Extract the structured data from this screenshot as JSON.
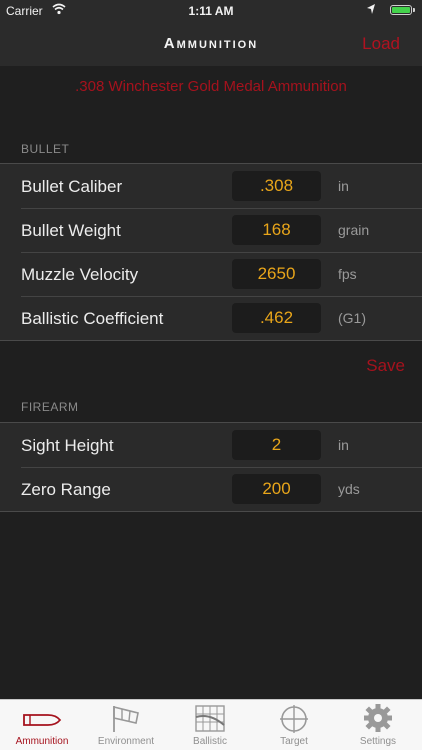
{
  "status": {
    "carrier": "Carrier",
    "time": "1:11 AM"
  },
  "nav": {
    "title": "Ammunition",
    "load_label": "Load"
  },
  "ammo_name": ".308 Winchester Gold Medal Ammunition",
  "bullet_section": {
    "header": "BULLET",
    "rows": [
      {
        "label": "Bullet Caliber",
        "value": ".308",
        "unit": "in"
      },
      {
        "label": "Bullet Weight",
        "value": "168",
        "unit": "grain"
      },
      {
        "label": "Muzzle Velocity",
        "value": "2650",
        "unit": "fps"
      },
      {
        "label": "Ballistic Coefficient",
        "value": ".462",
        "unit": "(G1)"
      }
    ]
  },
  "save_label": "Save",
  "firearm_section": {
    "header": "FIREARM",
    "rows": [
      {
        "label": "Sight Height",
        "value": "2",
        "unit": "in"
      },
      {
        "label": "Zero Range",
        "value": "200",
        "unit": "yds"
      }
    ]
  },
  "tabs": [
    {
      "label": "Ammunition",
      "icon": "bullet-icon"
    },
    {
      "label": "Environment",
      "icon": "windsock-icon"
    },
    {
      "label": "Ballistic",
      "icon": "ballistic-chart-icon"
    },
    {
      "label": "Target",
      "icon": "crosshair-icon"
    },
    {
      "label": "Settings",
      "icon": "gear-icon"
    }
  ],
  "colors": {
    "accent": "#a5121d",
    "value": "#e8a51a",
    "battery": "#44d34c"
  }
}
